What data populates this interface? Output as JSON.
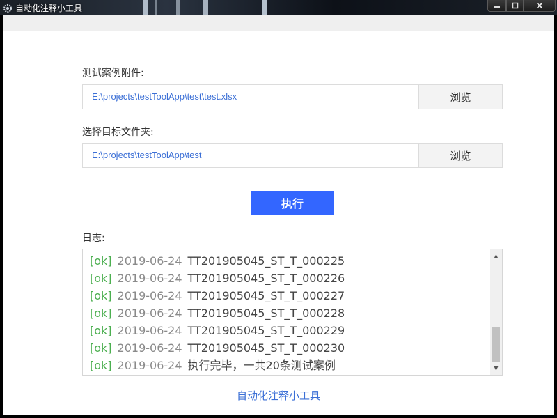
{
  "window": {
    "title": "自动化注释小工具"
  },
  "form": {
    "attachment_label": "测试案例附件:",
    "attachment_path": "E:\\projects\\testToolApp\\test\\test.xlsx",
    "folder_label": "选择目标文件夹:",
    "folder_path": "E:\\projects\\testToolApp\\test",
    "browse_label": "浏览",
    "execute_label": "执行"
  },
  "log": {
    "label": "日志:",
    "entries": [
      {
        "status": "[ok]",
        "date": "2019-06-24",
        "message": "TT201905045_ST_T_000225"
      },
      {
        "status": "[ok]",
        "date": "2019-06-24",
        "message": "TT201905045_ST_T_000226"
      },
      {
        "status": "[ok]",
        "date": "2019-06-24",
        "message": "TT201905045_ST_T_000227"
      },
      {
        "status": "[ok]",
        "date": "2019-06-24",
        "message": "TT201905045_ST_T_000228"
      },
      {
        "status": "[ok]",
        "date": "2019-06-24",
        "message": "TT201905045_ST_T_000229"
      },
      {
        "status": "[ok]",
        "date": "2019-06-24",
        "message": "TT201905045_ST_T_000230"
      },
      {
        "status": "[ok]",
        "date": "2019-06-24",
        "message": "执行完毕，一共20条测试案例"
      }
    ]
  },
  "footer": {
    "link_text": "自动化注释小工具"
  },
  "colors": {
    "accent": "#3366ff",
    "link": "#3b6fd6",
    "ok": "#4caf50"
  }
}
